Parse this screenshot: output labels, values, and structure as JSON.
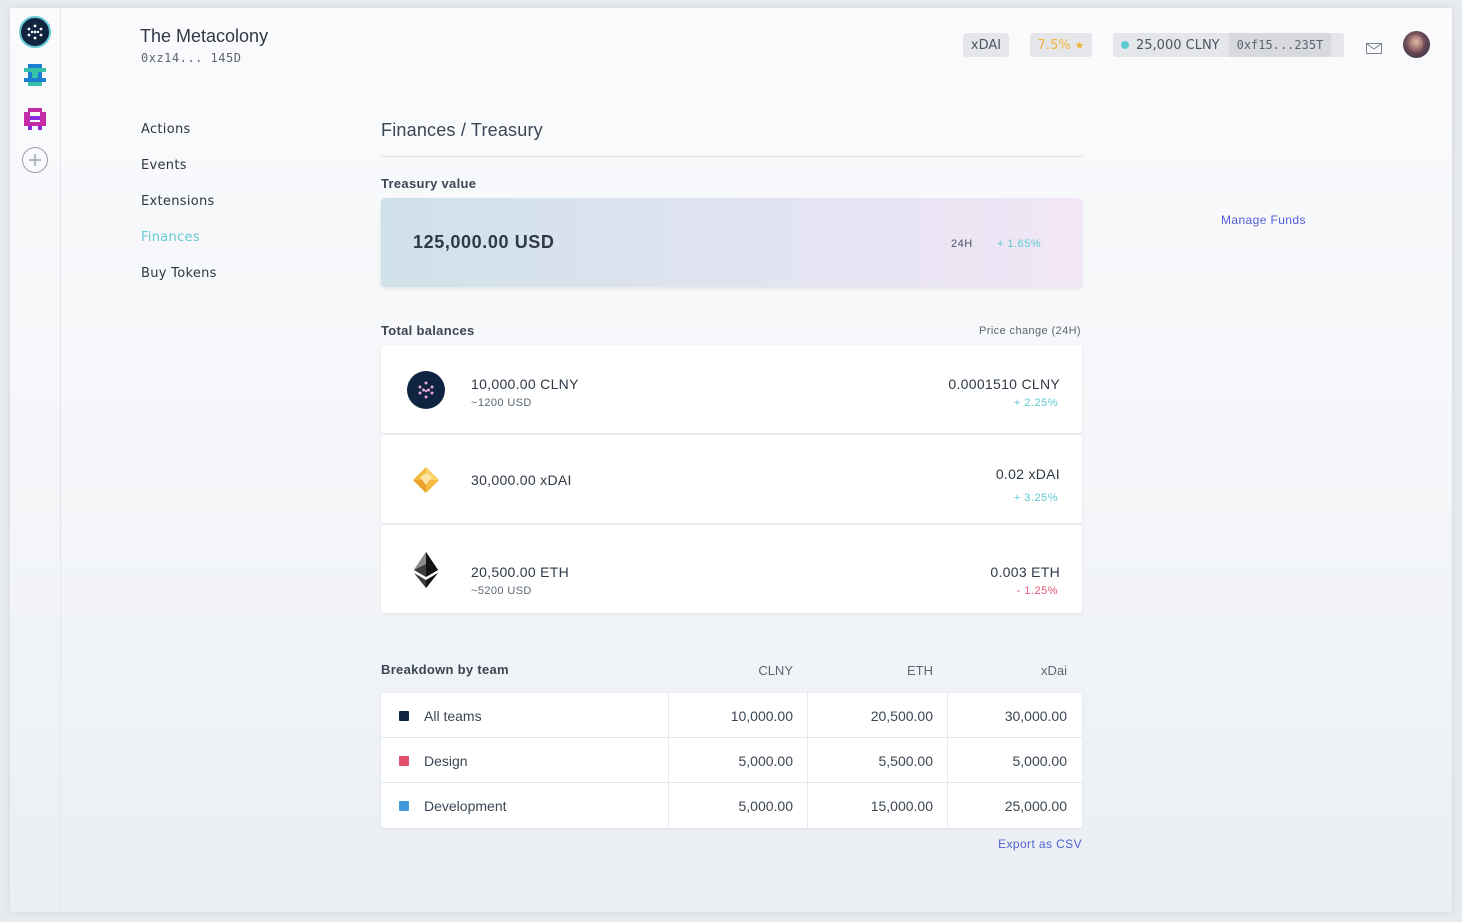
{
  "header": {
    "colony_name": "The Metacolony",
    "colony_address": "0xz14... 145D",
    "network": "xDAI",
    "reputation": "7.5%",
    "reputation_icon": "star-icon",
    "balance": "25,000 CLNY",
    "wallet_address": "0xf15...235T",
    "inbox_icon": "envelope-icon"
  },
  "sidebar": {
    "items": [
      {
        "label": "Actions"
      },
      {
        "label": "Events"
      },
      {
        "label": "Extensions"
      },
      {
        "label": "Finances",
        "active": true
      },
      {
        "label": "Buy Tokens"
      }
    ]
  },
  "main": {
    "breadcrumb": "Finances / Treasury",
    "treasury": {
      "label": "Treasury value",
      "value": "125,000.00 USD",
      "period": "24H",
      "change": "+ 1.65%"
    },
    "balances": {
      "label": "Total balances",
      "price_label": "Price change (24H)",
      "tokens": [
        {
          "amount": "10,000.00 CLNY",
          "usd": "~1200 USD",
          "price": "0.0001510 CLNY",
          "change": "+ 2.25%",
          "icon": "clny-icon"
        },
        {
          "amount": "30,000.00 xDAI",
          "usd": "",
          "price": "0.02 xDAI",
          "change": "+ 3.25%",
          "icon": "xdai-icon"
        },
        {
          "amount": "20,500.00 ETH",
          "usd": "~5200 USD",
          "price": "0.003 ETH",
          "change": "- 1.25%",
          "icon": "eth-icon"
        }
      ]
    },
    "breakdown": {
      "label": "Breakdown by team",
      "columns": [
        "CLNY",
        "ETH",
        "xDai"
      ],
      "rows": [
        {
          "team": "All teams",
          "color": "#0e2440",
          "values": [
            "10,000.00",
            "20,500.00",
            "30,000.00"
          ]
        },
        {
          "team": "Design",
          "color": "#e4506b",
          "values": [
            "5,000.00",
            "5,500.00",
            "5,000.00"
          ]
        },
        {
          "team": "Development",
          "color": "#3f98d8",
          "values": [
            "5,000.00",
            "15,000.00",
            "25,000.00"
          ]
        }
      ],
      "export_label": "Export as CSV"
    },
    "manage_funds": "Manage Funds"
  },
  "colors": {
    "accent": "#67c9d2",
    "link": "#4f5fd4",
    "positive": "#5ccbd0",
    "negative": "#e95673"
  }
}
